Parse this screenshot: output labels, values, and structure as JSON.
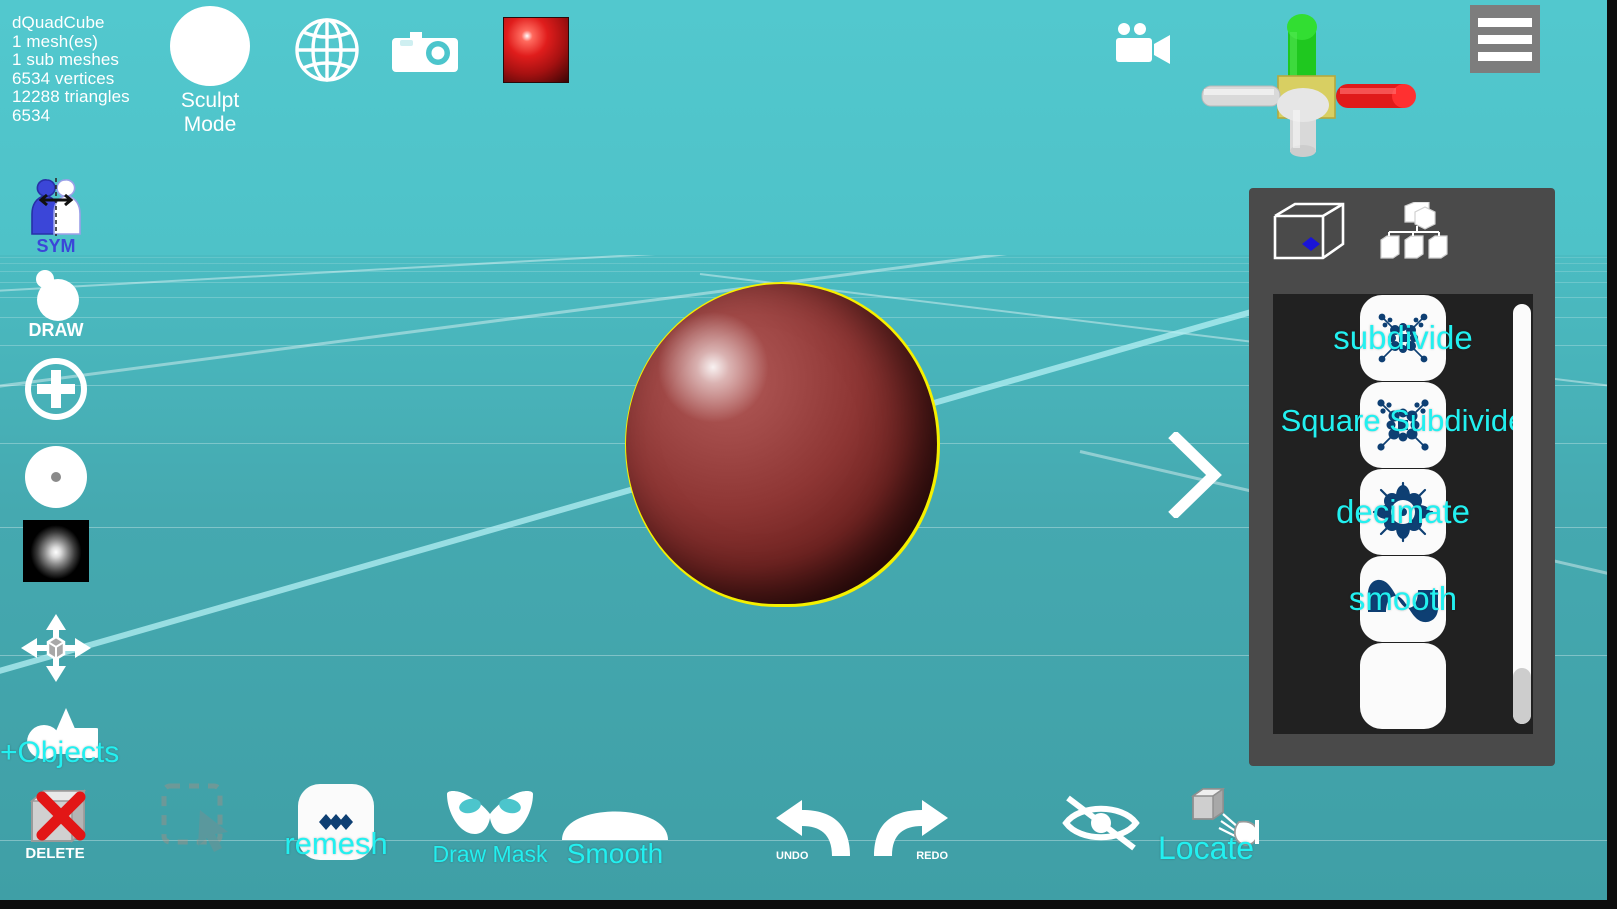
{
  "app": {
    "background_color": "#4cc5cc",
    "panel_color": "#4a4a4a",
    "accent_cyan": "#22f0f0",
    "selection_outline": "#f5f000"
  },
  "stats": {
    "object_name": "dQuadCube",
    "meshes": "1 mesh(es)",
    "sub_meshes": "1 sub meshes",
    "vertices": "6534 vertices",
    "triangles": "12288 triangles",
    "extra": "6534"
  },
  "topbar": {
    "sculpt_mode_label": "Sculpt Mode",
    "globe_icon": "globe-icon",
    "camera_icon": "camera-icon",
    "material_icon": "material-sphere-thumbnail",
    "videocam_icon": "video-camera-icon",
    "menu_icon": "hamburger-menu-icon",
    "gizmo_icon": "transform-gizmo",
    "gizmo_axis_colors": {
      "up": "#1fc81f",
      "right": "#e01a1a",
      "left": "#d9d9d9",
      "down": "#d9d9d9",
      "center": "#d8cf62"
    }
  },
  "left_toolbar": [
    {
      "name": "symmetry",
      "label": "SYM",
      "icon": "symmetry-icon"
    },
    {
      "name": "draw",
      "label": "DRAW",
      "icon": "draw-brush-icon"
    },
    {
      "name": "add",
      "label": "",
      "icon": "plus-circle-icon"
    },
    {
      "name": "brush-size",
      "label": "",
      "icon": "brush-size-icon"
    },
    {
      "name": "brush-alpha",
      "label": "",
      "icon": "brush-falloff-texture-icon"
    },
    {
      "name": "move",
      "label": "",
      "icon": "move-gizmo-icon"
    },
    {
      "name": "objects",
      "label": "+Objects",
      "icon": "primitive-shapes-icon"
    }
  ],
  "bottom_toolbar": [
    {
      "name": "delete",
      "label": "DELETE",
      "icon": "delete-cube-icon"
    },
    {
      "name": "select-box",
      "label": "",
      "icon": "selection-box-cursor-icon"
    },
    {
      "name": "remesh",
      "label": "remesh",
      "icon": "remesh-diamonds-icon"
    },
    {
      "name": "draw-mask",
      "label": "Draw Mask",
      "icon": "mask-icon"
    },
    {
      "name": "smooth",
      "label": "Smooth",
      "icon": "smooth-dome-icon"
    },
    {
      "name": "undo",
      "label": "UNDO",
      "icon": "undo-arrow-icon"
    },
    {
      "name": "redo",
      "label": "REDO",
      "icon": "redo-arrow-icon"
    },
    {
      "name": "hide",
      "label": "",
      "icon": "eye-off-icon"
    },
    {
      "name": "locate",
      "label": "Locate",
      "icon": "locate-cube-icon"
    }
  ],
  "right_panel": {
    "tabs": [
      {
        "name": "wireframe-cube",
        "icon": "wireframe-cube-icon"
      },
      {
        "name": "scene-hierarchy",
        "icon": "hierarchy-tree-icon"
      }
    ],
    "list_items": [
      {
        "label": "subdivide",
        "icon": "subdivide-icon",
        "two_line": false
      },
      {
        "label": "Square Subdivide",
        "icon": "square-subdivide-icon",
        "two_line": true
      },
      {
        "label": "decimate",
        "icon": "decimate-icon",
        "two_line": false
      },
      {
        "label": "smooth",
        "icon": "smooth-wave-icon",
        "two_line": false
      },
      {
        "label": "",
        "icon": "partial-item-icon",
        "two_line": false
      }
    ]
  },
  "viewport": {
    "next_arrow_icon": "chevron-right-icon",
    "object_icon": "red-sphere-mesh"
  }
}
